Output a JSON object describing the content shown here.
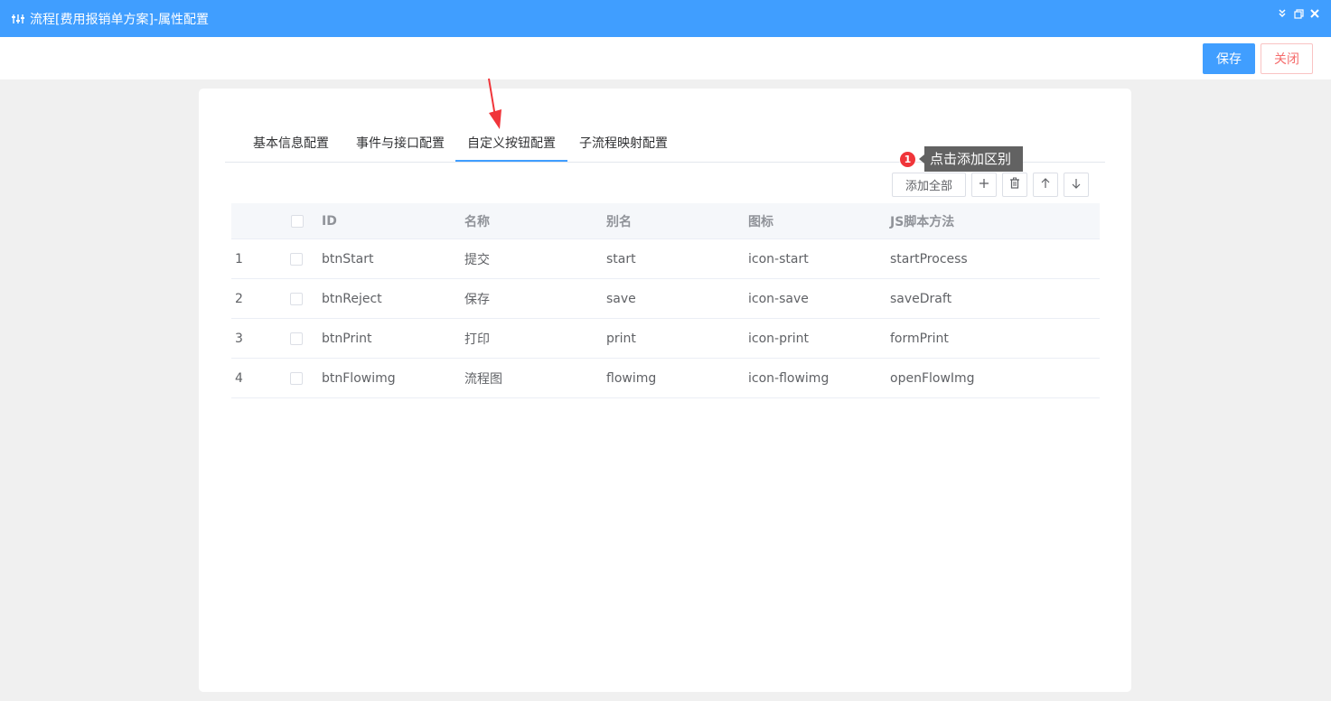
{
  "window": {
    "title": "流程[费用报销单方案]-属性配置",
    "controls": [
      "collapse-icon",
      "restore-icon",
      "close-icon"
    ]
  },
  "toolbar": {
    "save_label": "保存",
    "close_label": "关闭"
  },
  "tabs": [
    {
      "label": "基本信息配置",
      "active": false
    },
    {
      "label": "事件与接口配置",
      "active": false
    },
    {
      "label": "自定义按钮配置",
      "active": true
    },
    {
      "label": "子流程映射配置",
      "active": false
    }
  ],
  "tip": {
    "badge": "1",
    "text": "点击添加区别"
  },
  "grid_actions": {
    "add_all_label": "添加全部",
    "icons": [
      "plus-icon",
      "trash-icon",
      "arrow-up-icon",
      "arrow-down-icon"
    ]
  },
  "grid": {
    "columns": [
      "ID",
      "名称",
      "别名",
      "图标",
      "JS脚本方法"
    ],
    "rows": [
      {
        "index": "1",
        "id": "btnStart",
        "name": "提交",
        "alias": "start",
        "icon": "icon-start",
        "script": "startProcess"
      },
      {
        "index": "2",
        "id": "btnReject",
        "name": "保存",
        "alias": "save",
        "icon": "icon-save",
        "script": "saveDraft"
      },
      {
        "index": "3",
        "id": "btnPrint",
        "name": "打印",
        "alias": "print",
        "icon": "icon-print",
        "script": "formPrint"
      },
      {
        "index": "4",
        "id": "btnFlowimg",
        "name": "流程图",
        "alias": "flowimg",
        "icon": "icon-flowimg",
        "script": "openFlowImg"
      }
    ]
  },
  "colors": {
    "primary": "#409eff",
    "danger": "#f56c6c",
    "annotation": "#f0353a"
  }
}
